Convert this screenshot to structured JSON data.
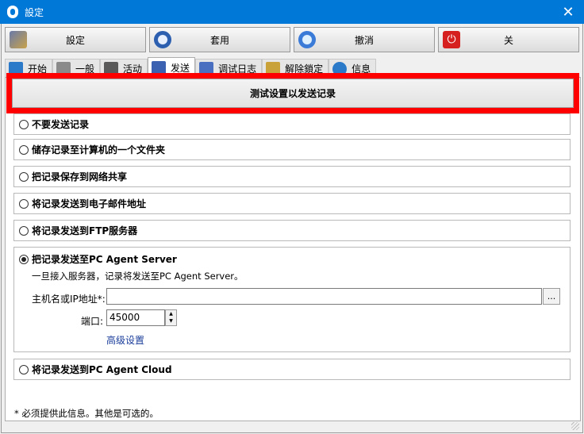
{
  "window": {
    "title": "設定"
  },
  "toolbar": {
    "settings_label": "設定",
    "apply_label": "套用",
    "undo_label": "撤消",
    "close_label": "关"
  },
  "tabs": [
    {
      "label": "开始",
      "icon": "play-icon"
    },
    {
      "label": "一般",
      "icon": "tools-icon"
    },
    {
      "label": "活动",
      "icon": "activity-icon"
    },
    {
      "label": "发送",
      "icon": "send-icon"
    },
    {
      "label": "调试日志",
      "icon": "log-icon"
    },
    {
      "label": "解除鎖定",
      "icon": "unlock-icon"
    },
    {
      "label": "信息",
      "icon": "info-icon"
    }
  ],
  "test_button": "测试设置以发送记录",
  "options": [
    {
      "label": "不要发送记录",
      "selected": false
    },
    {
      "label": "储存记录至计算机的一个文件夹",
      "selected": false
    },
    {
      "label": "把记录保存到网络共享",
      "selected": false
    },
    {
      "label": "将记录发送到电子邮件地址",
      "selected": false
    },
    {
      "label": "将记录发送到FTP服务器",
      "selected": false
    },
    {
      "label": "把记录发送至PC Agent Server",
      "selected": true
    },
    {
      "label": "将记录发送到PC Agent Cloud",
      "selected": false
    }
  ],
  "pc_agent_server": {
    "description": "一旦接入服务器，记录将发送至PC Agent Server。",
    "host_label": "主机名或IP地址*:",
    "host_value": "",
    "browse_label": "...",
    "port_label": "端口:",
    "port_value": "45000",
    "advanced_link": "高级设置"
  },
  "footnote": "* 必须提供此信息。其他是可选的。",
  "colors": {
    "titlebar": "#0078d7",
    "highlight": "#ff0000",
    "link": "#1a3d9a"
  }
}
